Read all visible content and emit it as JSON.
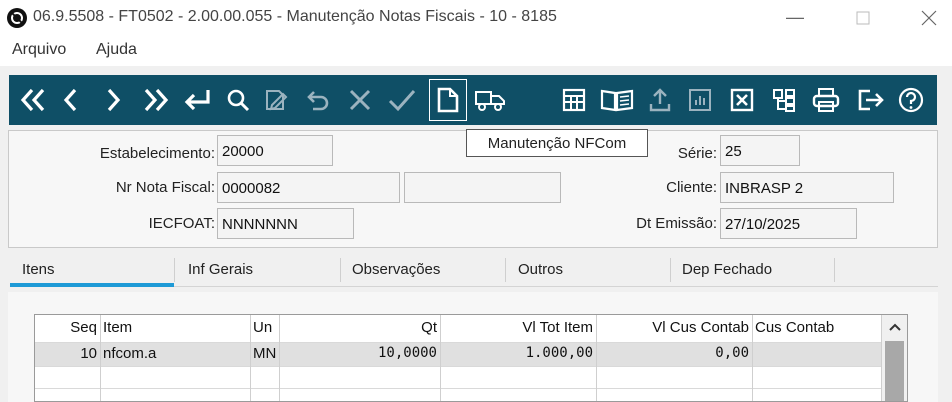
{
  "window": {
    "title": "06.9.5508 - FT0502 - 2.00.00.055 - Manutenção Notas Fiscais - 10 - 8185",
    "icon": "app-logo-icon",
    "controls": [
      "minimize-icon",
      "maximize-icon",
      "close-icon"
    ]
  },
  "menu": {
    "file": "Arquivo",
    "help": "Ajuda"
  },
  "toolbar": {
    "background": "#0f4f66",
    "icons": [
      "first-record-icon",
      "previous-record-icon",
      "next-record-icon",
      "last-record-icon",
      "goto-icon",
      "search-icon",
      "edit-icon",
      "undo-icon",
      "delete-icon",
      "confirm-icon",
      "nfcom-document-icon",
      "transport-icon",
      "calculator-icon",
      "book-icon",
      "upload-icon",
      "chart-icon",
      "cancel-box-icon",
      "tree-icon",
      "print-icon",
      "exit-icon",
      "help-icon"
    ],
    "tooltip": "Manutenção NFCom"
  },
  "header": {
    "estabelecimento_label": "Estabelecimento:",
    "estabelecimento_value": "20000",
    "serie_label": "Série:",
    "serie_value": "25",
    "nr_nota_label": "Nr Nota Fiscal:",
    "nr_nota_value": "0000082",
    "nr_nota_extra": "",
    "cliente_label": "Cliente:",
    "cliente_value": "INBRASP 2",
    "iecfoat_label": "IECFOAT:",
    "iecfoat_value": "NNNNNNN",
    "dt_emissao_label": "Dt Emissão:",
    "dt_emissao_value": "27/10/2025"
  },
  "tabs": [
    {
      "label": "Itens",
      "active": true
    },
    {
      "label": "Inf Gerais",
      "active": false
    },
    {
      "label": "Observações",
      "active": false
    },
    {
      "label": "Outros",
      "active": false
    },
    {
      "label": "Dep Fechado",
      "active": false
    }
  ],
  "accent_color": "#1e9ad6",
  "grid": {
    "columns": [
      "Seq",
      "Item",
      "Un",
      "Qt",
      "Vl Tot Item",
      "Vl Cus Contab",
      "Cus Contab"
    ],
    "rows": [
      {
        "seq": "10",
        "item": "nfcom.a",
        "un": "MN",
        "qt": "10,0000",
        "vl_tot_item": "1.000,00",
        "vl_cus_contab": "0,00",
        "cus_contab": ""
      }
    ]
  }
}
